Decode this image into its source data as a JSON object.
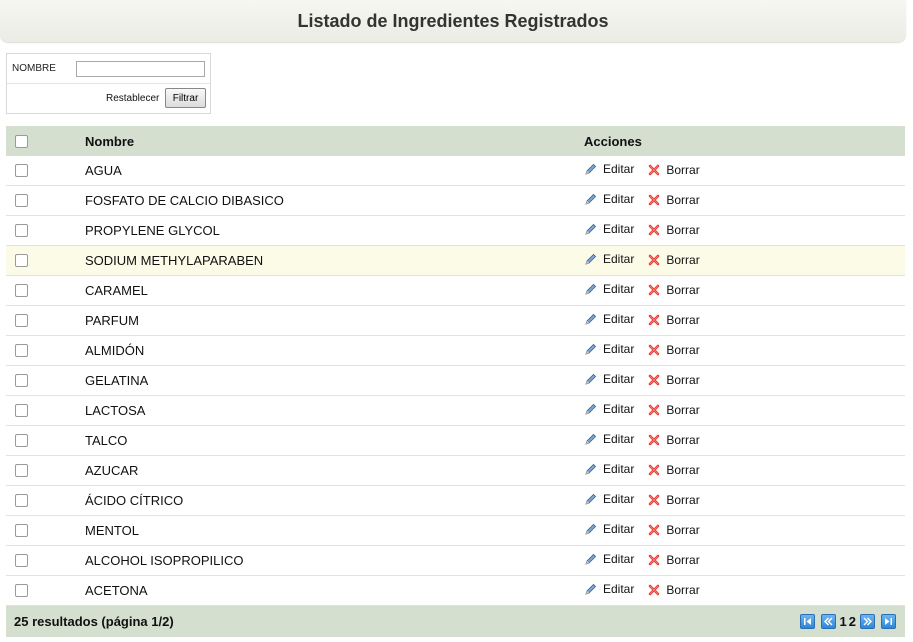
{
  "header": {
    "title": "Listado de Ingredientes Registrados"
  },
  "filter": {
    "label": "NOMBRE",
    "input_value": "",
    "reset_label": "Restablecer",
    "submit_label": "Filtrar"
  },
  "table": {
    "columns": {
      "name": "Nombre",
      "actions": "Acciones"
    },
    "edit_label": "Editar",
    "delete_label": "Borrar",
    "rows": [
      "AGUA",
      "FOSFATO DE CALCIO DIBASICO",
      "PROPYLENE GLYCOL",
      "SODIUM METHYLAPARABEN",
      "CARAMEL",
      "PARFUM",
      "ALMIDÓN",
      "GELATINA",
      "LACTOSA",
      "TALCO",
      "AZUCAR",
      "ÁCIDO CÍTRICO",
      "MENTOL",
      "ALCOHOL ISOPROPILICO",
      "ACETONA"
    ]
  },
  "footer": {
    "results": "25 resultados (página 1/2)",
    "pages": [
      "1",
      "2"
    ]
  },
  "colors": {
    "header_bg": "#d4dfd0",
    "highlight_row": "#fbfbe8",
    "pager_blue": "#2f86d8"
  }
}
